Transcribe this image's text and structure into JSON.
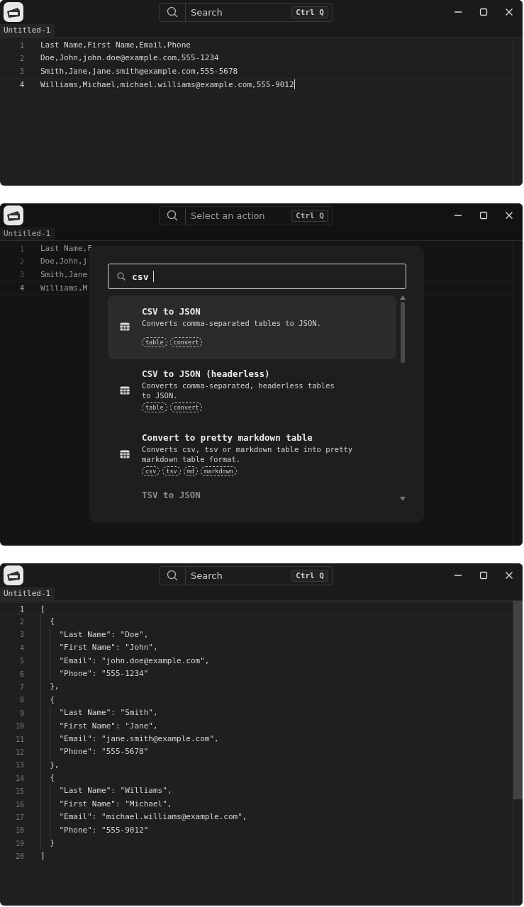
{
  "windows": [
    {
      "title_search": {
        "label": "Search",
        "shortcut": "Ctrl Q"
      },
      "tab": {
        "label": "Untitled-1"
      },
      "editor": {
        "lines": [
          {
            "number": "1",
            "text": "Last Name,First Name,Email,Phone",
            "current": false,
            "caret": false
          },
          {
            "number": "2",
            "text": "Doe,John,john.doe@example.com,555-1234",
            "current": false,
            "caret": false
          },
          {
            "number": "3",
            "text": "Smith,Jane,jane.smith@example.com,555-5678",
            "current": false,
            "caret": false
          },
          {
            "number": "4",
            "text": "Williams,Michael,michael.williams@example.com,555-9012",
            "current": true,
            "caret": true
          }
        ]
      }
    },
    {
      "title_search": {
        "label": "Select an action",
        "shortcut": "Ctrl Q"
      },
      "tab": {
        "label": "Untitled-1"
      },
      "editor": {
        "lines": [
          {
            "number": "1",
            "text": "Last Name,F",
            "current": false,
            "caret": false
          },
          {
            "number": "2",
            "text": "Doe,John,j",
            "current": false,
            "caret": false
          },
          {
            "number": "3",
            "text": "Smith,Jane",
            "current": false,
            "caret": false
          },
          {
            "number": "4",
            "text": "Williams,M",
            "current": true,
            "caret": false
          }
        ]
      },
      "palette": {
        "query": "csv",
        "items": [
          {
            "title": "CSV to JSON",
            "description": "Converts comma-separated tables to JSON.",
            "tags": [
              "table",
              "convert"
            ],
            "selected": true
          },
          {
            "title": "CSV to JSON (headerless)",
            "description": "Converts comma-separated, headerless tables\nto JSON.",
            "tags": [
              "table",
              "convert"
            ],
            "selected": false
          },
          {
            "title": "Convert to pretty markdown table",
            "description": "Converts csv, tsv or markdown table into pretty\nmarkdown table format.",
            "tags": [
              "csv",
              "tsv",
              "md",
              "markdown"
            ],
            "selected": false
          },
          {
            "title": "TSV to JSON",
            "selected": false
          }
        ]
      }
    },
    {
      "title_search": {
        "label": "Search",
        "shortcut": "Ctrl Q"
      },
      "tab": {
        "label": "Untitled-1"
      },
      "editor": {
        "lines": [
          {
            "number": "1",
            "text": "[",
            "current": true,
            "caret": false
          },
          {
            "number": "2",
            "text": "  {",
            "current": false,
            "caret": false
          },
          {
            "number": "3",
            "text": "    \"Last Name\": \"Doe\",",
            "current": false,
            "caret": false
          },
          {
            "number": "4",
            "text": "    \"First Name\": \"John\",",
            "current": false,
            "caret": false
          },
          {
            "number": "5",
            "text": "    \"Email\": \"john.doe@example.com\",",
            "current": false,
            "caret": false
          },
          {
            "number": "6",
            "text": "    \"Phone\": \"555-1234\"",
            "current": false,
            "caret": false
          },
          {
            "number": "7",
            "text": "  },",
            "current": false,
            "caret": false
          },
          {
            "number": "8",
            "text": "  {",
            "current": false,
            "caret": false
          },
          {
            "number": "9",
            "text": "    \"Last Name\": \"Smith\",",
            "current": false,
            "caret": false
          },
          {
            "number": "10",
            "text": "    \"First Name\": \"Jane\",",
            "current": false,
            "caret": false
          },
          {
            "number": "11",
            "text": "    \"Email\": \"jane.smith@example.com\",",
            "current": false,
            "caret": false
          },
          {
            "number": "12",
            "text": "    \"Phone\": \"555-5678\"",
            "current": false,
            "caret": false
          },
          {
            "number": "13",
            "text": "  },",
            "current": false,
            "caret": false
          },
          {
            "number": "14",
            "text": "  {",
            "current": false,
            "caret": false
          },
          {
            "number": "15",
            "text": "    \"Last Name\": \"Williams\",",
            "current": false,
            "caret": false
          },
          {
            "number": "16",
            "text": "    \"First Name\": \"Michael\",",
            "current": false,
            "caret": false
          },
          {
            "number": "17",
            "text": "    \"Email\": \"michael.williams@example.com\",",
            "current": false,
            "caret": false
          },
          {
            "number": "18",
            "text": "    \"Phone\": \"555-9012\"",
            "current": false,
            "caret": false
          },
          {
            "number": "19",
            "text": "  }",
            "current": false,
            "caret": false
          },
          {
            "number": "20",
            "text": "]",
            "current": false,
            "caret": false
          }
        ]
      }
    }
  ]
}
